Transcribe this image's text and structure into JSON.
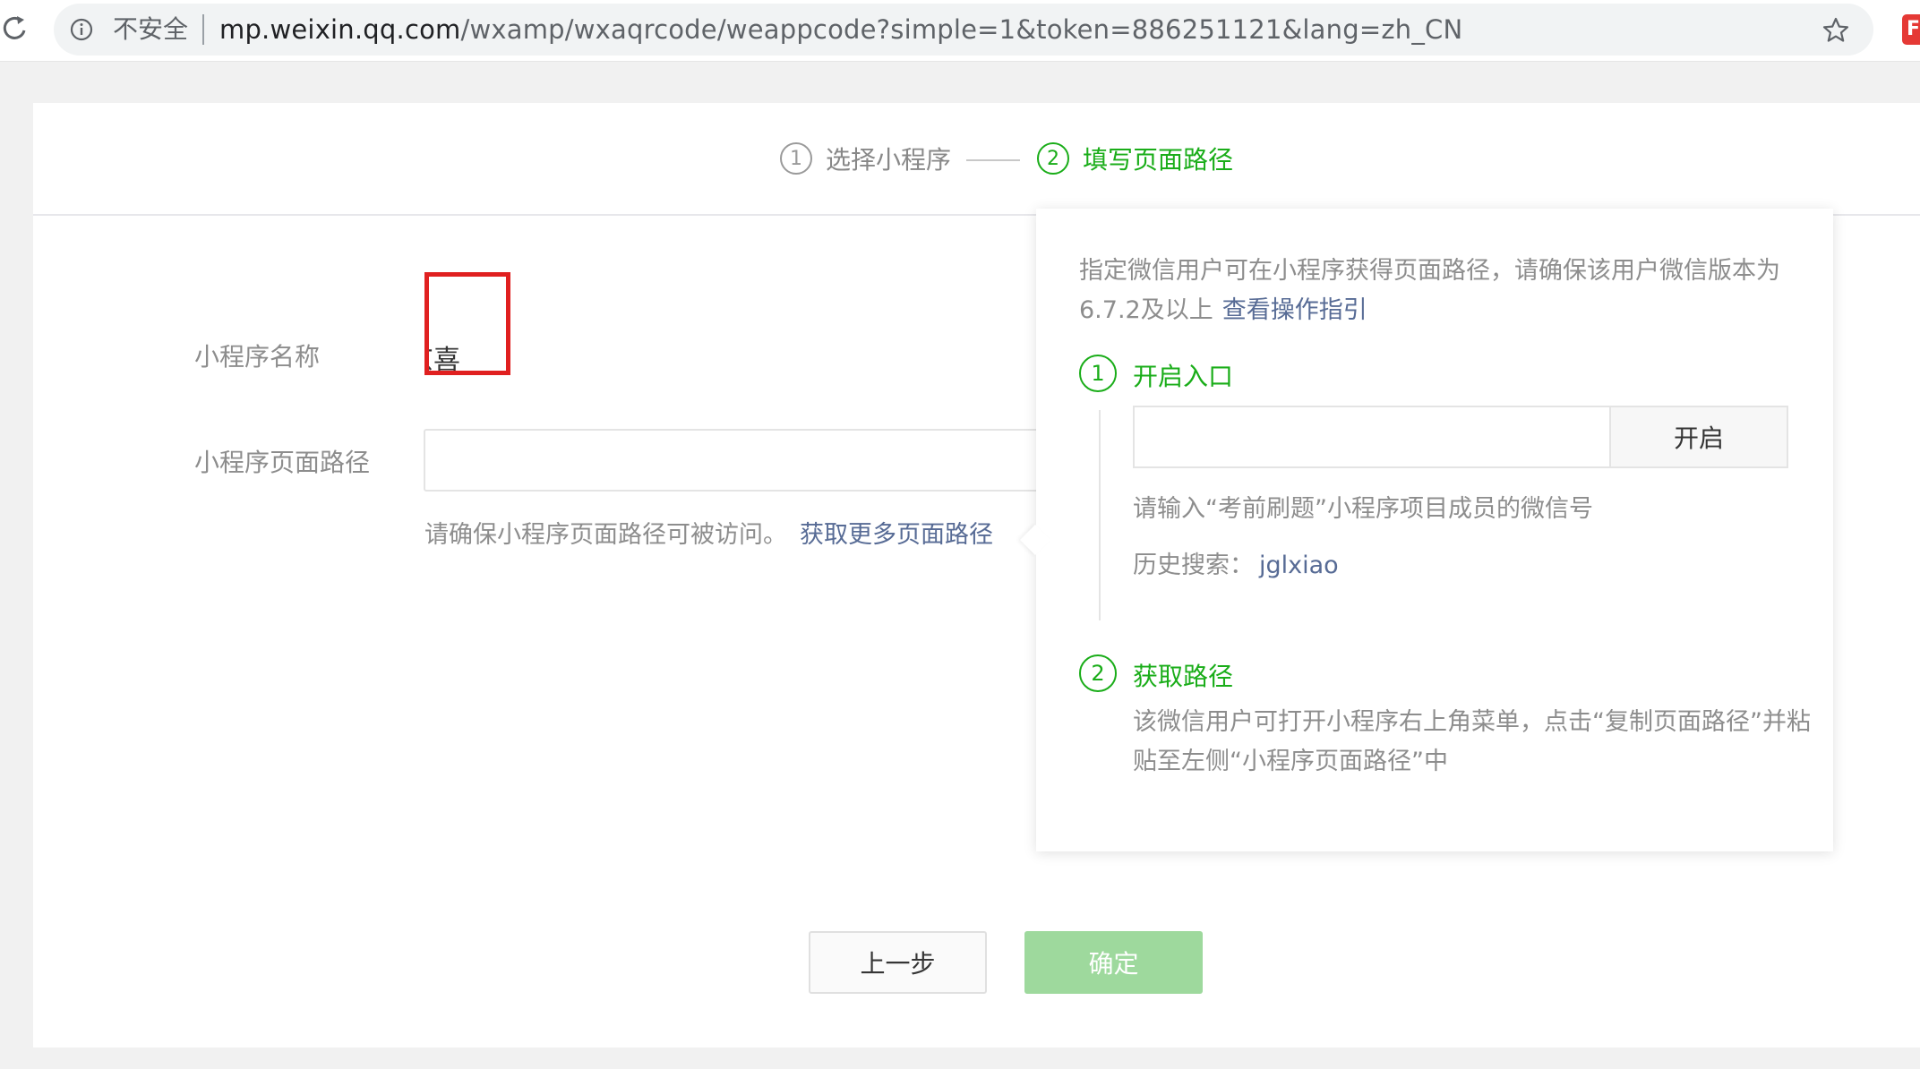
{
  "browser": {
    "security_label": "不安全",
    "url_host": "mp.weixin.qq.com",
    "url_path": "/wxamp/wxaqrcode/weappcode?simple=1&token=886251121&lang=zh_CN"
  },
  "steps": [
    {
      "num": "1",
      "label": "选择小程序"
    },
    {
      "num": "2",
      "label": "填写页面路径"
    }
  ],
  "form": {
    "name_label": "小程序名称",
    "name_value": "京喜",
    "path_label": "小程序页面路径",
    "path_value": "",
    "hint": "请确保小程序页面路径可被访问。",
    "hint_link": "获取更多页面路径"
  },
  "popover": {
    "intro": "指定微信用户可在小程序获得页面路径，请确保该用户微信版本为6.7.2及以上",
    "intro_link": "查看操作指引",
    "step1": {
      "num": "1",
      "title": "开启入口",
      "input_value": "",
      "button": "开启",
      "hint": "请输入“考前刷题”小程序项目成员的微信号",
      "history_label": "历史搜索：",
      "history_value": "jglxiao"
    },
    "step2": {
      "num": "2",
      "title": "获取路径",
      "description": "该微信用户可打开小程序右上角菜单，点击“复制页面路径”并粘贴至左侧“小程序页面路径”中"
    }
  },
  "buttons": {
    "prev": "上一步",
    "confirm": "确定"
  },
  "colors": {
    "accent_green": "#1aad19",
    "disabled_green": "#9ed99d",
    "link_blue": "#576b95",
    "highlight_red": "#e02020"
  }
}
